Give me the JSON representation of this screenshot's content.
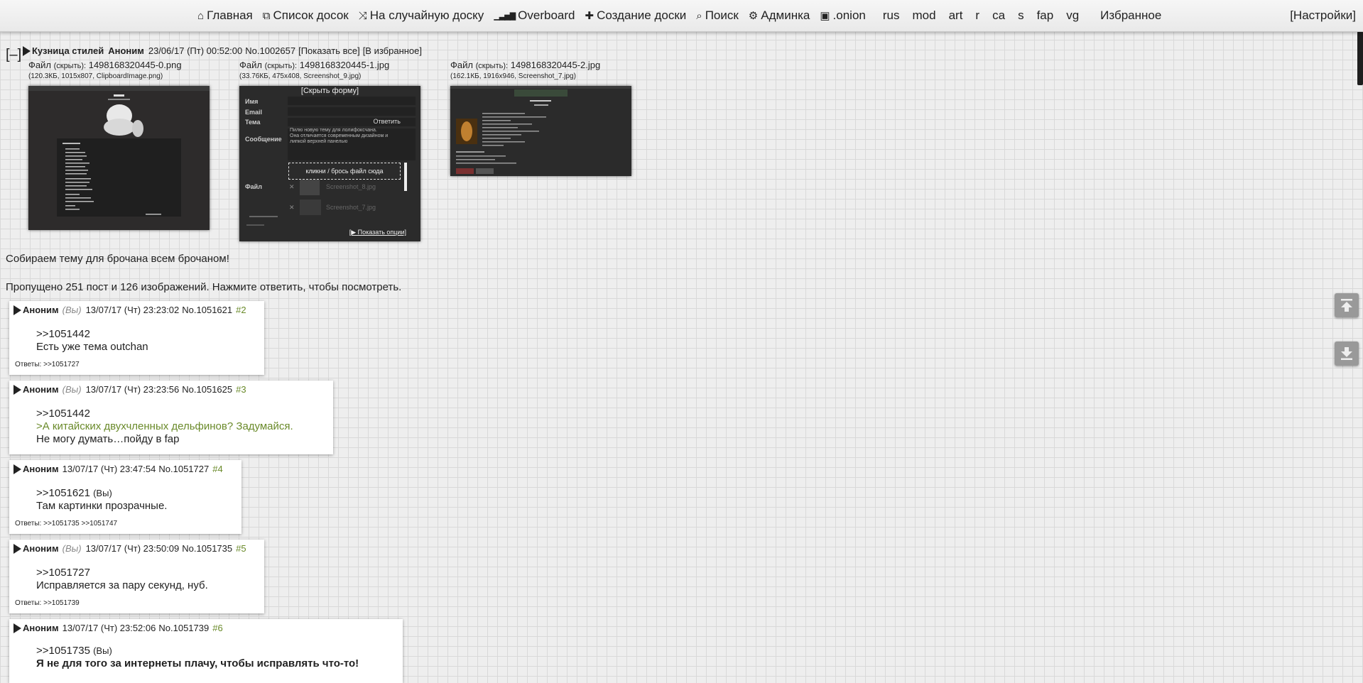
{
  "nav": {
    "items": [
      {
        "icon": "home-icon",
        "glyph": "⌂",
        "label": "Главная"
      },
      {
        "icon": "boards-list-icon",
        "glyph": "⧉",
        "label": "Список досок"
      },
      {
        "icon": "shuffle-icon",
        "glyph": "⤨",
        "label": "На случайную доску"
      },
      {
        "icon": "overboard-icon",
        "glyph": "▁▃▅▇",
        "label": "Overboard"
      },
      {
        "icon": "plus-icon",
        "glyph": "✚",
        "label": "Создание доски"
      },
      {
        "icon": "search-icon",
        "glyph": "⌕",
        "label": "Поиск"
      },
      {
        "icon": "gear-icon",
        "glyph": "⚙",
        "label": "Админка"
      },
      {
        "icon": "onion-icon",
        "glyph": "▣",
        "label": ".onion"
      }
    ],
    "boards": [
      "rus",
      "mod",
      "art",
      "r",
      "ca",
      "s",
      "fap",
      "vg"
    ],
    "favorites": "Избранное",
    "settings": "[Настройки]"
  },
  "op": {
    "collapse": "[–]",
    "subject": "Кузница стилей",
    "name": "Аноним",
    "date": "23/06/17 (Пт) 00:52:00",
    "number": "No.1002657",
    "show_all": "[Показать все]",
    "favorite": "[В избранное]",
    "files": [
      {
        "label": "Файл",
        "hide": "(скрыть):",
        "name": "1498168320445-0.png",
        "info": "(120.3КБ, 1015x807, ClipboardImage.png)"
      },
      {
        "label": "Файл",
        "hide": "(скрыть):",
        "name": "1498168320445-1.jpg",
        "info": "(33.76КБ, 475x408, Screenshot_9.jpg)"
      },
      {
        "label": "Файл",
        "hide": "(скрыть):",
        "name": "1498168320445-2.jpg",
        "info": "(162.1КБ, 1916x946, Screenshot_7.jpg)"
      }
    ],
    "thumb2": {
      "hide_form": "[Скрыть форму]",
      "rows": [
        "Имя",
        "Email",
        "Тема",
        "Сообщение",
        "Файл"
      ],
      "submit": "Ответить",
      "message": [
        "Пилю новую тему для лолифоксчана.",
        "Она отличается современным дизайном и",
        "липкой верхней панелью"
      ],
      "drop": "кликни / брось файл сюда",
      "file1": "Screenshot_8.jpg",
      "file2": "Screenshot_7.jpg",
      "options": "[▶ Показать опции]"
    },
    "text": "Собираем тему для брочана всем брочаном!",
    "omitted": "Пропущено 251 пост и 126 изображений. Нажмите ответить, чтобы посмотреть."
  },
  "replies": [
    {
      "name": "Аноним",
      "you": "(Вы)",
      "date": "13/07/17 (Чт) 23:23:02",
      "number": "No.1051621",
      "idx": "#2",
      "lines": [
        ">>1051442",
        "Есть уже тема outchan"
      ],
      "replies": "Ответы: >>1051727"
    },
    {
      "name": "Аноним",
      "you": "(Вы)",
      "date": "13/07/17 (Чт) 23:23:56",
      "number": "No.1051625",
      "idx": "#3",
      "lines": [
        ">>1051442",
        ">А китайских двухчленных дельфинов? Задумайся.",
        "Не могу думать…пойду в fap"
      ],
      "replies": ""
    },
    {
      "name": "Аноним",
      "you": "",
      "date": "13/07/17 (Чт) 23:47:54",
      "number": "No.1051727",
      "idx": "#4",
      "lines": [
        ">>1051621",
        "Там картинки прозрачные."
      ],
      "line0_suffix": "(Вы)",
      "replies": "Ответы: >>1051735 >>1051747"
    },
    {
      "name": "Аноним",
      "you": "(Вы)",
      "date": "13/07/17 (Чт) 23:50:09",
      "number": "No.1051735",
      "idx": "#5",
      "lines": [
        ">>1051727",
        "Исправляется за пару секунд, нуб."
      ],
      "replies": "Ответы: >>1051739"
    },
    {
      "name": "Аноним",
      "you": "",
      "date": "13/07/17 (Чт) 23:52:06",
      "number": "No.1051739",
      "idx": "#6",
      "lines": [
        ">>1051735",
        "Я не для того за интернеты плачу, чтобы исправлять что-то!"
      ],
      "line0_suffix": "(Вы)",
      "replies": ""
    }
  ]
}
